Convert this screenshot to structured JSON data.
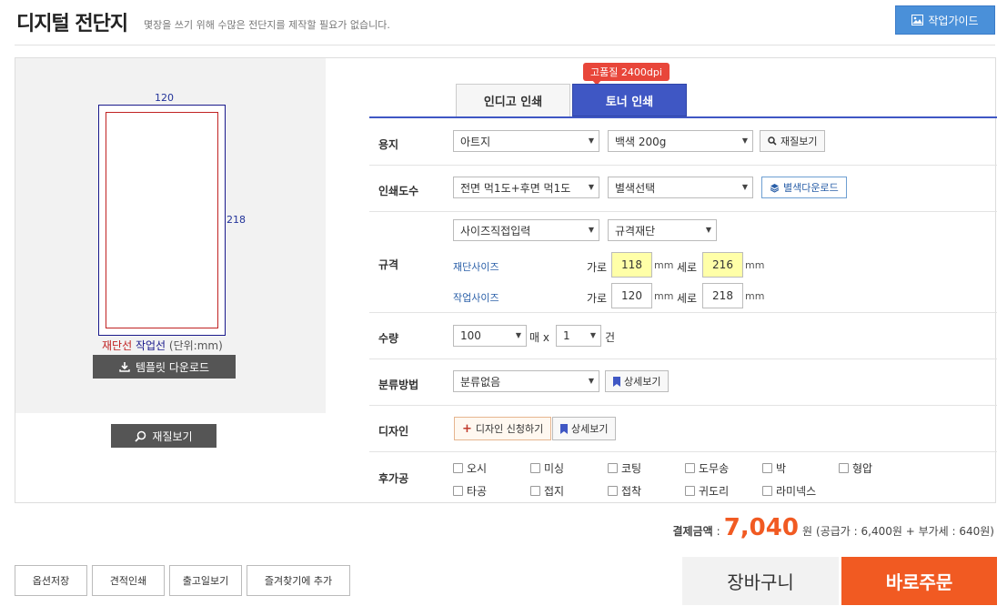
{
  "header": {
    "title": "디지털 전단지",
    "subtitle": "몇장을 쓰기 위해 수많은 전단지를 제작할 필요가 없습니다.",
    "guide_button": "작업가이드"
  },
  "preview": {
    "width_label": "120",
    "height_label": "218",
    "legend_cut": "재단선",
    "legend_work": "작업선",
    "legend_unit": "(단위:mm)",
    "template_button": "템플릿 다운로드",
    "material_button": "재질보기"
  },
  "tabs": {
    "indigo": "인디고 인쇄",
    "toner": "토너 인쇄",
    "badge": "고품질 2400dpi",
    "active": "toner"
  },
  "paper": {
    "label": "용지",
    "type": "아트지",
    "weight": "백색 200g",
    "material_button": "재질보기"
  },
  "color": {
    "label": "인쇄도수",
    "value": "전면 먹1도+후면 먹1도",
    "special": "별색선택",
    "download_button": "별색다운로드"
  },
  "size": {
    "label": "규격",
    "input_mode": "사이즈직접입력",
    "cut_mode": "규격재단",
    "cut_size_label": "재단사이즈",
    "work_size_label": "작업사이즈",
    "width_label": "가로",
    "height_label": "세로",
    "unit": "mm",
    "cut_width": "118",
    "cut_height": "216",
    "work_width": "120",
    "work_height": "218"
  },
  "quantity": {
    "label": "수량",
    "sheets": "100",
    "sheets_unit": "매 x",
    "count": "1",
    "count_unit": "건"
  },
  "sorting": {
    "label": "분류방법",
    "value": "분류없음",
    "detail_button": "상세보기"
  },
  "design": {
    "label": "디자인",
    "apply_button": "디자인 신청하기",
    "detail_button": "상세보기"
  },
  "post": {
    "label": "후가공",
    "options": [
      "오시",
      "미싱",
      "코팅",
      "도무송",
      "박",
      "형압",
      "타공",
      "접지",
      "접착",
      "귀도리",
      "라미넥스"
    ]
  },
  "price": {
    "label": "결제금액",
    "colon": ":",
    "total": "7,040",
    "won": "원",
    "breakdown": "(공급가 : 6,400원 + 부가세 : 640원)"
  },
  "bottom": {
    "save_option": "옵션저장",
    "estimate_print": "견적인쇄",
    "ship_date": "출고일보기",
    "add_favorite": "즐겨찾기에 추가",
    "cart": "장바구니",
    "order_now": "바로주문"
  },
  "colors": {
    "accent": "#3f57c4",
    "order": "#f15a22",
    "highlight": "#ffffa8",
    "cut_line": "#c02222",
    "work_line": "#1a1a8c"
  }
}
